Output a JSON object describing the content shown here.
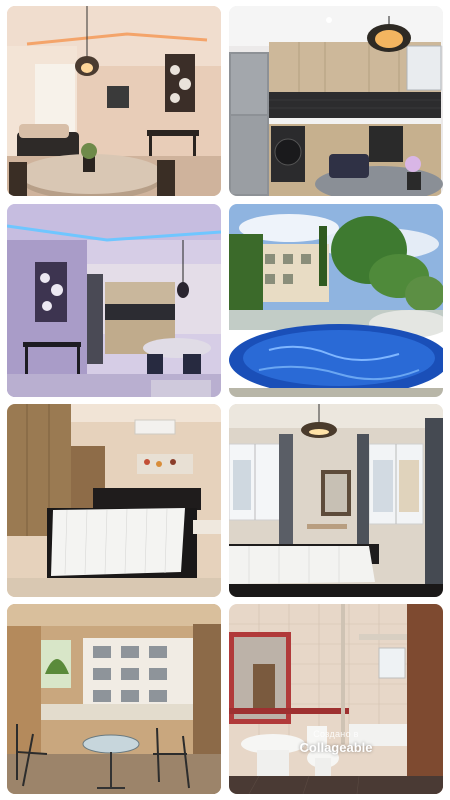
{
  "collage": {
    "tiles": [
      {
        "subject": "living-room"
      },
      {
        "subject": "kitchen"
      },
      {
        "subject": "open-plan-living-kitchen"
      },
      {
        "subject": "swimming-pool"
      },
      {
        "subject": "bedroom-wardrobe"
      },
      {
        "subject": "bedroom-window"
      },
      {
        "subject": "balcony"
      },
      {
        "subject": "bathroom"
      }
    ]
  },
  "watermark": {
    "line1": "Создано в",
    "line2": "Collageable"
  }
}
